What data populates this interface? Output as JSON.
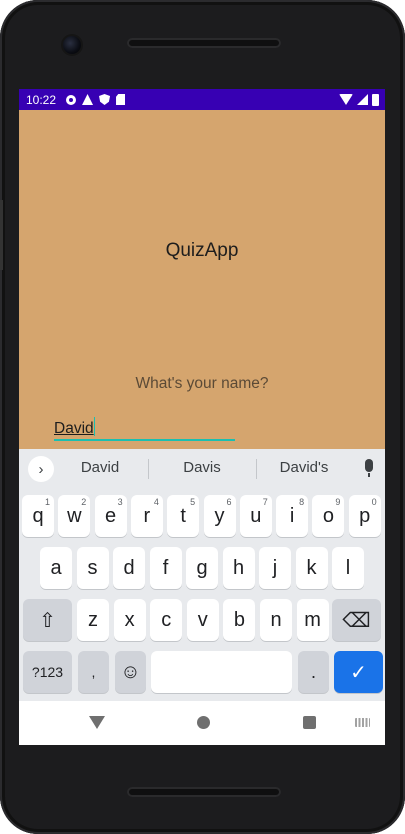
{
  "status_bar": {
    "time": "10:22"
  },
  "app": {
    "title": "QuizApp",
    "name_prompt": "What's your name?",
    "name_value": "David"
  },
  "keyboard": {
    "suggestions": [
      "David",
      "Davis",
      "David's"
    ],
    "expand_glyph": "›",
    "row1": [
      {
        "label": "q",
        "hint": "1"
      },
      {
        "label": "w",
        "hint": "2"
      },
      {
        "label": "e",
        "hint": "3"
      },
      {
        "label": "r",
        "hint": "4"
      },
      {
        "label": "t",
        "hint": "5"
      },
      {
        "label": "y",
        "hint": "6"
      },
      {
        "label": "u",
        "hint": "7"
      },
      {
        "label": "i",
        "hint": "8"
      },
      {
        "label": "o",
        "hint": "9"
      },
      {
        "label": "p",
        "hint": "0"
      }
    ],
    "row2": [
      "a",
      "s",
      "d",
      "f",
      "g",
      "h",
      "j",
      "k",
      "l"
    ],
    "row3": [
      "z",
      "x",
      "c",
      "v",
      "b",
      "n",
      "m"
    ],
    "shift_glyph": "⇧",
    "backspace_glyph": "⌫",
    "symbols_label": "?123",
    "comma_label": ",",
    "emoji_glyph": "☺",
    "period_label": ".",
    "enter_glyph": "✓"
  },
  "colors": {
    "app_background": "#d5a56e",
    "status_bar": "#3700b3",
    "input_underline": "#1bbfb0",
    "enter_key": "#1a73e8"
  }
}
